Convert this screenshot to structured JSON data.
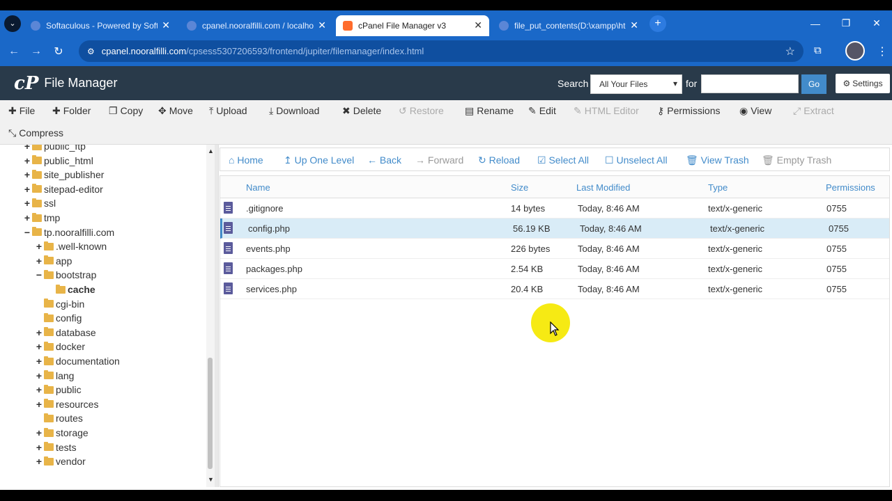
{
  "browser": {
    "tabs": [
      {
        "title": "Softaculous - Powered by Softa",
        "active": false
      },
      {
        "title": "cpanel.nooralfilli.com / localho",
        "active": false
      },
      {
        "title": "cPanel File Manager v3",
        "active": true
      },
      {
        "title": "file_put_contents(D:\\xampp\\htd",
        "active": false
      }
    ],
    "url_host": "cpanel.nooralfilli.com",
    "url_path": "/cpsess5307206593/frontend/jupiter/filemanager/index.html"
  },
  "header": {
    "logo": "cP",
    "title": "File Manager",
    "search_label": "Search",
    "search_scope": "All Your Files",
    "for_label": "for",
    "go_label": "Go",
    "settings_label": "Settings"
  },
  "toolbar": {
    "items": [
      {
        "label": "File",
        "icon": "plus-icon",
        "enabled": true
      },
      {
        "label": "Folder",
        "icon": "plus-icon",
        "enabled": true
      },
      {
        "label": "Copy",
        "icon": "copy-icon",
        "enabled": true
      },
      {
        "label": "Move",
        "icon": "move-icon",
        "enabled": true
      },
      {
        "label": "Upload",
        "icon": "upload-icon",
        "enabled": true
      },
      {
        "label": "Download",
        "icon": "download-icon",
        "enabled": true
      },
      {
        "label": "Delete",
        "icon": "delete-icon",
        "enabled": true
      },
      {
        "label": "Restore",
        "icon": "restore-icon",
        "enabled": false
      },
      {
        "label": "Rename",
        "icon": "rename-icon",
        "enabled": true
      },
      {
        "label": "Edit",
        "icon": "pencil-icon",
        "enabled": true
      },
      {
        "label": "HTML Editor",
        "icon": "html-editor-icon",
        "enabled": false
      },
      {
        "label": "Permissions",
        "icon": "key-icon",
        "enabled": true
      },
      {
        "label": "View",
        "icon": "eye-icon",
        "enabled": true
      },
      {
        "label": "Extract",
        "icon": "extract-icon",
        "enabled": false
      },
      {
        "label": "Compress",
        "icon": "compress-icon",
        "enabled": true
      }
    ]
  },
  "tree": {
    "nodes": [
      {
        "label": "public_ftp",
        "level": 0,
        "toggle": "+",
        "bold": false
      },
      {
        "label": "public_html",
        "level": 0,
        "toggle": "+",
        "bold": false
      },
      {
        "label": "site_publisher",
        "level": 0,
        "toggle": "+",
        "bold": false
      },
      {
        "label": "sitepad-editor",
        "level": 0,
        "toggle": "+",
        "bold": false
      },
      {
        "label": "ssl",
        "level": 0,
        "toggle": "+",
        "bold": false
      },
      {
        "label": "tmp",
        "level": 0,
        "toggle": "+",
        "bold": false
      },
      {
        "label": "tp.nooralfilli.com",
        "level": 0,
        "toggle": "−",
        "bold": false
      },
      {
        "label": ".well-known",
        "level": 1,
        "toggle": "+",
        "bold": false
      },
      {
        "label": "app",
        "level": 1,
        "toggle": "+",
        "bold": false
      },
      {
        "label": "bootstrap",
        "level": 1,
        "toggle": "−",
        "bold": false
      },
      {
        "label": "cache",
        "level": 2,
        "toggle": "",
        "bold": true
      },
      {
        "label": "cgi-bin",
        "level": 1,
        "toggle": "",
        "bold": false
      },
      {
        "label": "config",
        "level": 1,
        "toggle": "",
        "bold": false
      },
      {
        "label": "database",
        "level": 1,
        "toggle": "+",
        "bold": false
      },
      {
        "label": "docker",
        "level": 1,
        "toggle": "+",
        "bold": false
      },
      {
        "label": "documentation",
        "level": 1,
        "toggle": "+",
        "bold": false
      },
      {
        "label": "lang",
        "level": 1,
        "toggle": "+",
        "bold": false
      },
      {
        "label": "public",
        "level": 1,
        "toggle": "+",
        "bold": false
      },
      {
        "label": "resources",
        "level": 1,
        "toggle": "+",
        "bold": false
      },
      {
        "label": "routes",
        "level": 1,
        "toggle": "",
        "bold": false
      },
      {
        "label": "storage",
        "level": 1,
        "toggle": "+",
        "bold": false
      },
      {
        "label": "tests",
        "level": 1,
        "toggle": "+",
        "bold": false
      },
      {
        "label": "vendor",
        "level": 1,
        "toggle": "+",
        "bold": false
      }
    ]
  },
  "nav": {
    "home": "Home",
    "up": "Up One Level",
    "back": "Back",
    "forward": "Forward",
    "reload": "Reload",
    "select_all": "Select All",
    "unselect_all": "Unselect All",
    "view_trash": "View Trash",
    "empty_trash": "Empty Trash"
  },
  "grid": {
    "columns": [
      "Name",
      "Size",
      "Last Modified",
      "Type",
      "Permissions"
    ],
    "rows": [
      {
        "name": ".gitignore",
        "size": "14 bytes",
        "modified": "Today, 8:46 AM",
        "type": "text/x-generic",
        "perms": "0755",
        "selected": false
      },
      {
        "name": "config.php",
        "size": "56.19 KB",
        "modified": "Today, 8:46 AM",
        "type": "text/x-generic",
        "perms": "0755",
        "selected": true
      },
      {
        "name": "events.php",
        "size": "226 bytes",
        "modified": "Today, 8:46 AM",
        "type": "text/x-generic",
        "perms": "0755",
        "selected": false
      },
      {
        "name": "packages.php",
        "size": "2.54 KB",
        "modified": "Today, 8:46 AM",
        "type": "text/x-generic",
        "perms": "0755",
        "selected": false
      },
      {
        "name": "services.php",
        "size": "20.4 KB",
        "modified": "Today, 8:46 AM",
        "type": "text/x-generic",
        "perms": "0755",
        "selected": false
      }
    ]
  },
  "colors": {
    "accent": "#428bca",
    "header_bg": "#293a4a",
    "browser_blue": "#1a68c8",
    "folder": "#e8b448"
  }
}
